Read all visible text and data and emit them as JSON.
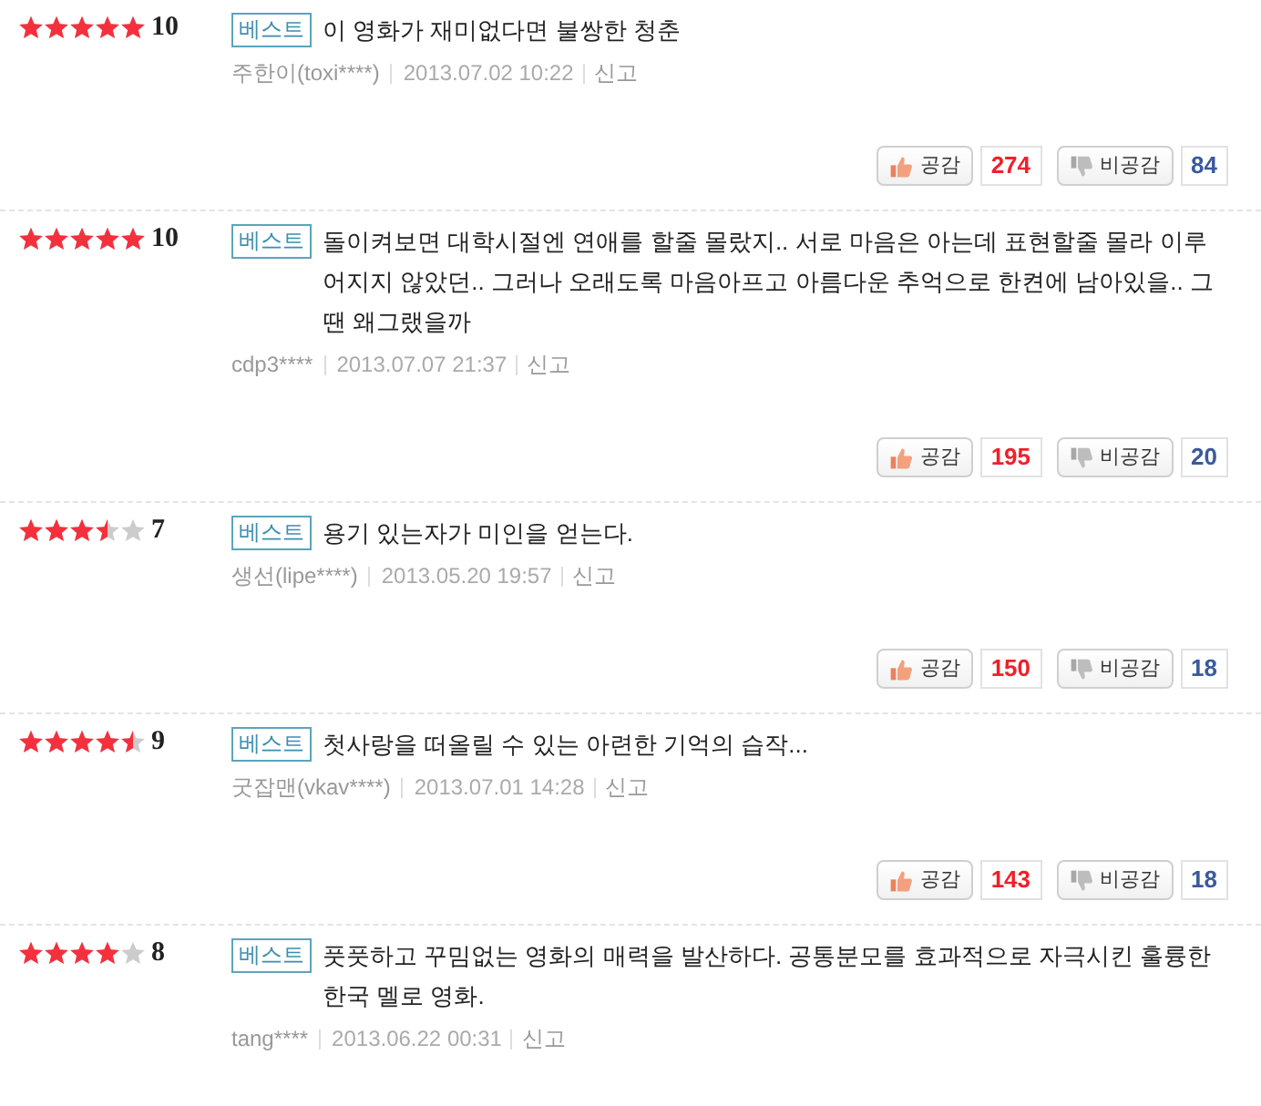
{
  "reviews": [
    {
      "stars": 5,
      "score": "10",
      "badge": "베스트",
      "text": "이 영화가 재미없다면 불쌍한 청춘",
      "author": "주한이(toxi****)",
      "date": "2013.07.02 10:22",
      "report": "신고",
      "like": {
        "label": "공감",
        "count": "274"
      },
      "dislike": {
        "label": "비공감",
        "count": "84"
      }
    },
    {
      "stars": 5,
      "score": "10",
      "badge": "베스트",
      "text": "돌이켜보면 대학시절엔 연애를 할줄 몰랐지.. 서로 마음은 아는데 표현할줄 몰라 이루어지지 않았던.. 그러나 오래도록 마음아프고 아름다운 추억으로 한켠에 남아있을.. 그땐 왜그랬을까",
      "author": "cdp3****",
      "date": "2013.07.07 21:37",
      "report": "신고",
      "like": {
        "label": "공감",
        "count": "195"
      },
      "dislike": {
        "label": "비공감",
        "count": "20"
      }
    },
    {
      "stars": 3.5,
      "score": "7",
      "badge": "베스트",
      "text": "용기 있는자가 미인을 얻는다.",
      "author": "생선(lipe****)",
      "date": "2013.05.20 19:57",
      "report": "신고",
      "like": {
        "label": "공감",
        "count": "150"
      },
      "dislike": {
        "label": "비공감",
        "count": "18"
      }
    },
    {
      "stars": 4.5,
      "score": "9",
      "badge": "베스트",
      "text": "첫사랑을 떠올릴 수 있는 아련한 기억의 습작...",
      "author": "굿잡맨(vkav****)",
      "date": "2013.07.01 14:28",
      "report": "신고",
      "like": {
        "label": "공감",
        "count": "143"
      },
      "dislike": {
        "label": "비공감",
        "count": "18"
      }
    },
    {
      "stars": 4,
      "score": "8",
      "badge": "베스트",
      "text": "풋풋하고 꾸밈없는 영화의 매력을 발산하다. 공통분모를 효과적으로 자극시킨 훌륭한 한국 멜로 영화.",
      "author": "tang****",
      "date": "2013.06.22 00:31",
      "report": "신고"
    }
  ]
}
